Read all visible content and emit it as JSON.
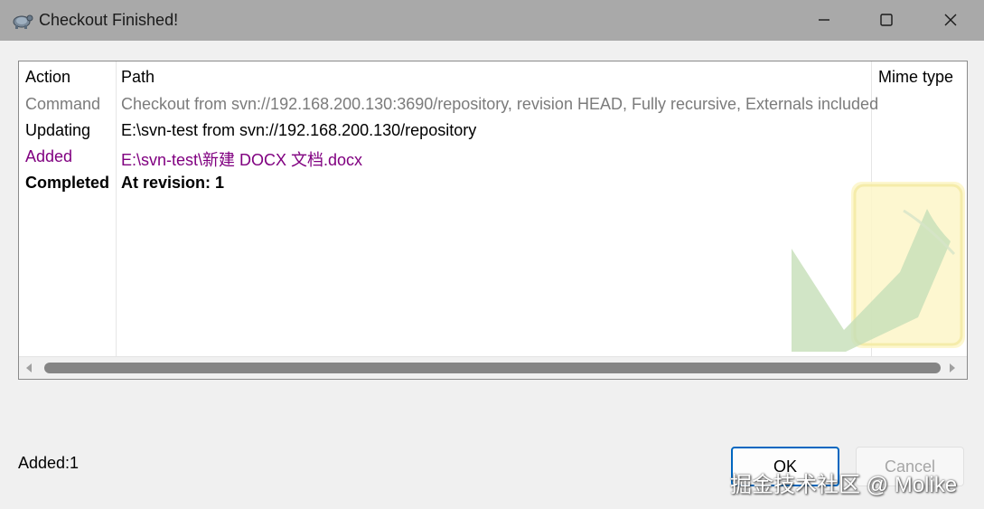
{
  "window": {
    "title": "Checkout Finished!",
    "icon": "tortoisesvn-icon",
    "controls": [
      "minimize-icon",
      "maximize-icon",
      "close-icon"
    ]
  },
  "list": {
    "columns": [
      "Action",
      "Path",
      "Mime type"
    ],
    "rows": [
      {
        "action": "Command",
        "path": "Checkout from svn://192.168.200.130:3690/repository, revision HEAD, Fully recursive, Externals included",
        "color": "#7b7b7b"
      },
      {
        "action": "Updating",
        "path": "E:\\svn-test from svn://192.168.200.130/repository",
        "color": "#000000"
      },
      {
        "action": "Added",
        "path": "E:\\svn-test\\新建 DOCX 文档.docx",
        "color": "#800080"
      },
      {
        "action": "Completed",
        "path": "At revision: 1",
        "color": "#000000"
      }
    ]
  },
  "status": {
    "summary": "Added:1"
  },
  "buttons": {
    "ok": "OK",
    "cancel": "Cancel"
  },
  "overlay": {
    "credit": "掘金技术社区 @ Molike"
  },
  "colors": {
    "accent": "#0067c0",
    "added": "#800080",
    "titlebar": "#a9a9a9"
  }
}
